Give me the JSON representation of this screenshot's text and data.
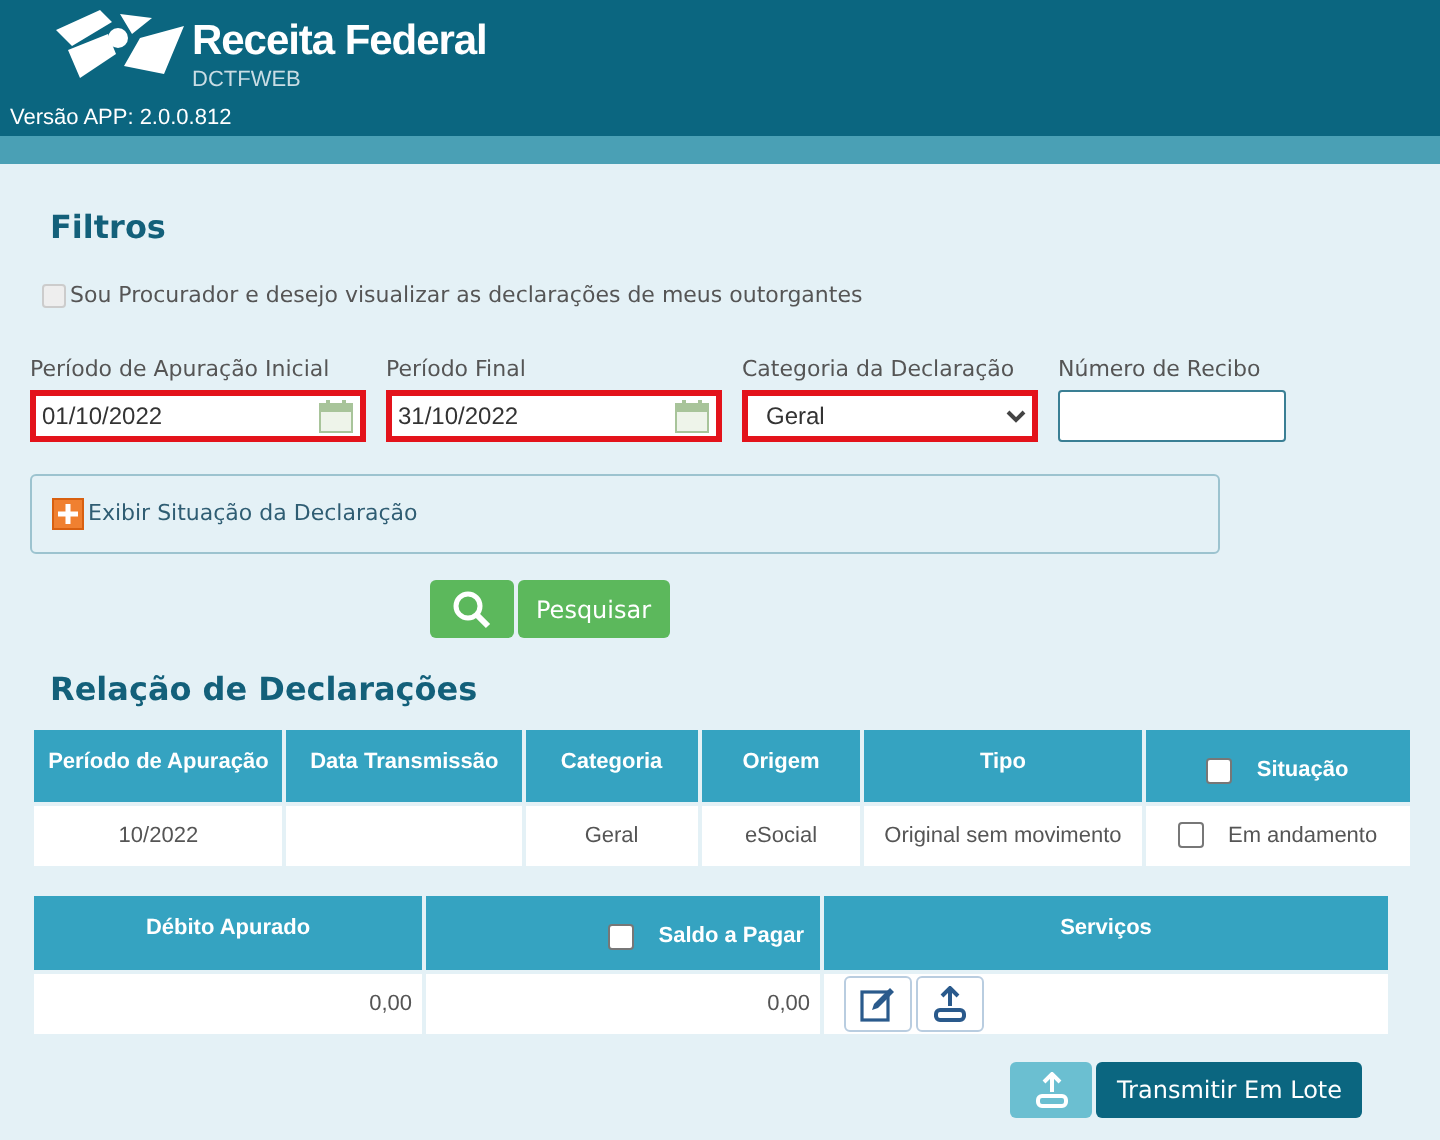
{
  "header": {
    "brand": "Receita Federal",
    "product": "DCTFWEB",
    "version": "Versão APP: 2.0.0.812"
  },
  "filters": {
    "title": "Filtros",
    "procurador": {
      "label": "Sou Procurador e desejo visualizar as declarações de meus outorgantes",
      "checked": false
    },
    "fields": [
      {
        "kind": "date",
        "label": "Período de Apuração Inicial",
        "value": "01/10/2022",
        "highlighted": true
      },
      {
        "kind": "date",
        "label": "Período Final",
        "value": "31/10/2022",
        "highlighted": true
      },
      {
        "kind": "select",
        "label": "Categoria da Declaração",
        "value": "Geral",
        "highlighted": true
      },
      {
        "kind": "text",
        "label": "Número de Recibo",
        "highlighted": false
      }
    ],
    "toggle": {
      "label": "Exibir Situação da Declaração",
      "expanded": false
    },
    "search_button": "Pesquisar"
  },
  "declarations": {
    "title": "Relação de Declarações",
    "columns": [
      {
        "kind": "plain",
        "label": "Período de Apuração"
      },
      {
        "kind": "plain",
        "label": "Data Transmissão"
      },
      {
        "kind": "plain",
        "label": "Categoria"
      },
      {
        "kind": "plain",
        "label": "Origem"
      },
      {
        "kind": "plain",
        "label": "Tipo"
      },
      {
        "kind": "checkbox",
        "label": "Situação",
        "checked": false
      }
    ],
    "rows": [
      {
        "cells": [
          "10/2022",
          "",
          "Geral",
          "eSocial",
          "Original sem movimento",
          "Em andamento"
        ],
        "checked": false
      }
    ],
    "detail_columns": [
      {
        "kind": "plain",
        "label": "Débito Apurado"
      },
      {
        "kind": "checkbox",
        "label": "Saldo a Pagar",
        "checked": false
      },
      {
        "kind": "plain",
        "label": "Serviços"
      }
    ],
    "detail_rows": [
      {
        "debito": "0,00",
        "saldo": "0,00"
      }
    ]
  },
  "batch_button": "Transmitir Em Lote"
}
